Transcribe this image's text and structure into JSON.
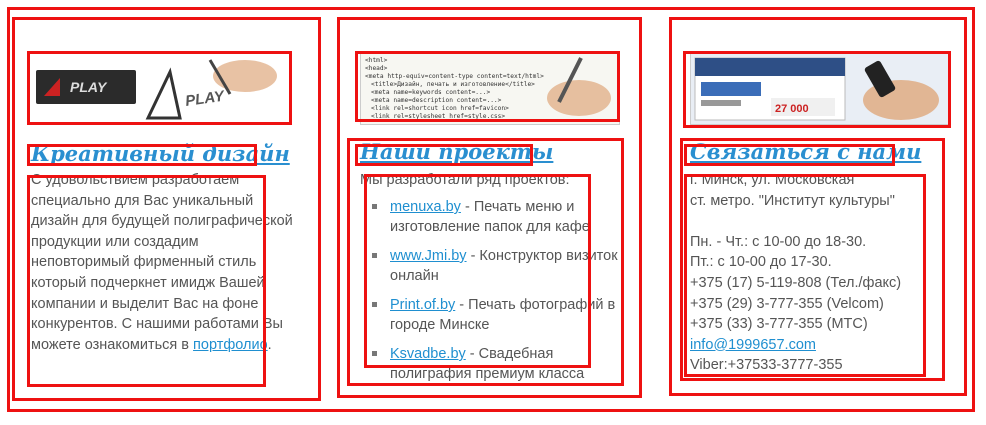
{
  "design": {
    "heading": "Креативный дизайн",
    "text_before_link": "С удовольствием разработаем специально для Вас уникальный дизайн для будущей полиграфической продукции или создадим неповторимый фирменный стиль который подчеркнет имидж Вашей компании и выделит Вас на фоне конкурентов. С нашими работами Вы можете ознакомиться в",
    "link": "портфолио",
    "text_after_link": ".",
    "banner_text": "PLAY"
  },
  "projects": {
    "heading": "Наши проекты",
    "intro": "Мы разработали ряд проектов:",
    "items": [
      {
        "link": "menuxa.by",
        "desc": " - Печать меню и изготовление папок для кафе"
      },
      {
        "link": "www.Jmi.by",
        "desc": " - Конструктор визиток онлайн"
      },
      {
        "link": "Print.of.by",
        "desc": " - Печать фотографий в городе Минске"
      },
      {
        "link": "Ksvadbe.by",
        "desc": " - Свадебная полиграфия премиум класса"
      }
    ],
    "banner_code": [
      "<html>",
      "<head>",
      "<meta http-equiv=content-type content=text/html>",
      "<title>Дизайн, печать и изготовление</title>",
      "<meta name=keywords content=...>",
      "<meta name=description content=...>",
      "<link rel=shortcut icon href=favicon>",
      "<link rel=stylesheet href=style.css>"
    ]
  },
  "contact": {
    "heading": "Связаться с нами",
    "address1": "г. Минск, ул. Московская",
    "address2": "ст. метро. \"Институт культуры\"",
    "hours1": "Пн. - Чт.: с 10-00 до 18-30.",
    "hours2": "Пт.: с 10-00 до 17-30.",
    "phone1": "+375 (17) 5-119-808 (Тел./факс)",
    "phone2": "+375 (29) 3-777-355 (Velcom)",
    "phone3": "+375 (33) 3-777-355 (МТС)",
    "email": "info@1999657.com",
    "viber": "Viber:+37533-3777-355",
    "banner_price": "27 000"
  },
  "colors": {
    "heading": "#2a8fd0",
    "link": "#1f8fd0",
    "frame": "#ee1111",
    "text": "#555555"
  }
}
